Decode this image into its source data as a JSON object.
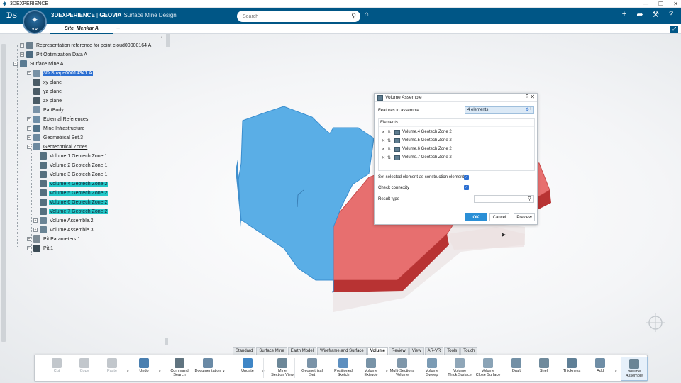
{
  "os": {
    "title": "3DEXPERIENCE",
    "min": "—",
    "restore": "❐",
    "close": "✕"
  },
  "header": {
    "brand_bold": "3DEXPERIENCE",
    "brand_sep": " | ",
    "brand_geovia": "GEOVIA",
    "app_name": "Surface Mine Design",
    "compass_version": "V.R",
    "search_placeholder": "Search",
    "colors": {
      "header_bg": "#005686",
      "selection_blue": "#2c6fd1",
      "selection_cyan": "#22c7c7",
      "solid_blue": "#5aaee6",
      "solid_red": "#e86a6a"
    }
  },
  "tabs": {
    "active": "Site_Menkar A",
    "add": "+"
  },
  "tree": {
    "nodes": [
      {
        "label": "Representation reference for point cloud00000164 A",
        "icon": "point-cloud-icon",
        "state": "normal"
      },
      {
        "label": "Pit Optimization Data A",
        "icon": "data-icon",
        "state": "normal"
      },
      {
        "label": "Surface Mine A",
        "icon": "surface-mine-icon",
        "state": "normal"
      },
      {
        "label": "3D Shape00014341 A",
        "icon": "shape-icon",
        "state": "selected-blue"
      },
      {
        "label": "xy plane",
        "icon": "plane-icon",
        "state": "normal"
      },
      {
        "label": "yz plane",
        "icon": "plane-icon",
        "state": "normal"
      },
      {
        "label": "zx plane",
        "icon": "plane-icon",
        "state": "normal"
      },
      {
        "label": "PartBody",
        "icon": "partbody-icon",
        "state": "normal"
      },
      {
        "label": "External References",
        "icon": "reference-icon",
        "state": "normal"
      },
      {
        "label": "Mine Infrastructure",
        "icon": "infrastructure-icon",
        "state": "normal"
      },
      {
        "label": "Geometrical Set.3",
        "icon": "geoset-icon",
        "state": "normal"
      },
      {
        "label": "Geotechnical Zones",
        "icon": "geoset-icon",
        "state": "underline"
      },
      {
        "label": "Volume.1 Geotech Zone 1",
        "icon": "volume-icon",
        "state": "normal"
      },
      {
        "label": "Volume.2 Geotech Zone 1",
        "icon": "volume-icon",
        "state": "normal"
      },
      {
        "label": "Volume.3 Geotech Zone 1",
        "icon": "volume-icon",
        "state": "normal"
      },
      {
        "label": "Volume.4 Geotech Zone 2",
        "icon": "volume-icon",
        "state": "selected-cyan"
      },
      {
        "label": "Volume.5 Geotech Zone 2",
        "icon": "volume-icon",
        "state": "selected-cyan"
      },
      {
        "label": "Volume.6 Geotech Zone 2",
        "icon": "volume-icon",
        "state": "selected-cyan"
      },
      {
        "label": "Volume.7 Geotech Zone 2",
        "icon": "volume-icon",
        "state": "selected-cyan"
      },
      {
        "label": "Volume Assemble.2",
        "icon": "volume-assemble-icon",
        "state": "normal"
      },
      {
        "label": "Volume Assemble.3",
        "icon": "volume-assemble-icon",
        "state": "normal"
      },
      {
        "label": "Pit Parameters.1",
        "icon": "parameters-icon",
        "state": "normal"
      },
      {
        "label": "Pit.1",
        "icon": "pit-icon",
        "state": "normal"
      }
    ]
  },
  "dialog": {
    "title": "Volume Assemble",
    "help": "?",
    "close": "✕",
    "features_label": "Features to assemble",
    "features_value": "4 elements",
    "elements_header": "Elements",
    "elements": [
      "Volume.4 Geotech Zone 2",
      "Volume.5 Geotech Zone 2",
      "Volume.6 Geotech Zone 2",
      "Volume.7 Geotech Zone 2"
    ],
    "construction_label": "Set selected element as construction element",
    "construction_checked": true,
    "connexity_label": "Check connexity",
    "connexity_checked": true,
    "result_label": "Result type",
    "result_value": "",
    "ok": "OK",
    "cancel": "Cancel",
    "preview": "Preview"
  },
  "section_tabs": [
    {
      "label": "Standard",
      "active": false
    },
    {
      "label": "Surface Mine",
      "active": false
    },
    {
      "label": "Earth Model",
      "active": false
    },
    {
      "label": "Wireframe and Surface",
      "active": false
    },
    {
      "label": "Volume",
      "active": true
    },
    {
      "label": "Review",
      "active": false
    },
    {
      "label": "View",
      "active": false
    },
    {
      "label": "AR-VR",
      "active": false
    },
    {
      "label": "Tools",
      "active": false
    },
    {
      "label": "Touch",
      "active": false
    }
  ],
  "toolbar": [
    {
      "label": "Cut",
      "icon": "scissors-icon",
      "disabled": true
    },
    {
      "label": "Copy",
      "icon": "copy-icon",
      "disabled": true
    },
    {
      "label": "Paste",
      "icon": "paste-icon",
      "disabled": true
    },
    {
      "label": "Undo",
      "icon": "undo-icon",
      "disabled": false
    },
    {
      "label": "Command\nSearch",
      "icon": "command-search-icon",
      "disabled": false
    },
    {
      "label": "Documentation",
      "icon": "documentation-icon",
      "disabled": false
    },
    {
      "label": "Update",
      "icon": "update-icon",
      "disabled": false
    },
    {
      "label": "Mine\nSection View",
      "icon": "mine-section-view-icon",
      "disabled": false
    },
    {
      "label": "Geometrical\nSet",
      "icon": "geometrical-set-icon",
      "disabled": false
    },
    {
      "label": "Positioned\nSketch",
      "icon": "positioned-sketch-icon",
      "disabled": false
    },
    {
      "label": "Volume\nExtrude",
      "icon": "volume-extrude-icon",
      "disabled": false
    },
    {
      "label": "Multi-Sections\nVolume",
      "icon": "multi-sections-volume-icon",
      "disabled": false
    },
    {
      "label": "Volume\nSweep",
      "icon": "volume-sweep-icon",
      "disabled": false
    },
    {
      "label": "Volume\nThick Surface",
      "icon": "volume-thick-surface-icon",
      "disabled": false
    },
    {
      "label": "Volume\nClose Surface",
      "icon": "volume-close-surface-icon",
      "disabled": false
    },
    {
      "label": "Draft",
      "icon": "draft-icon",
      "disabled": false
    },
    {
      "label": "Shell",
      "icon": "shell-icon",
      "disabled": false
    },
    {
      "label": "Thickness",
      "icon": "thickness-icon",
      "disabled": false
    },
    {
      "label": "Add",
      "icon": "add-icon",
      "disabled": false
    },
    {
      "label": "Volume\nAssemble",
      "icon": "volume-assemble-icon",
      "disabled": false,
      "active": true
    }
  ]
}
